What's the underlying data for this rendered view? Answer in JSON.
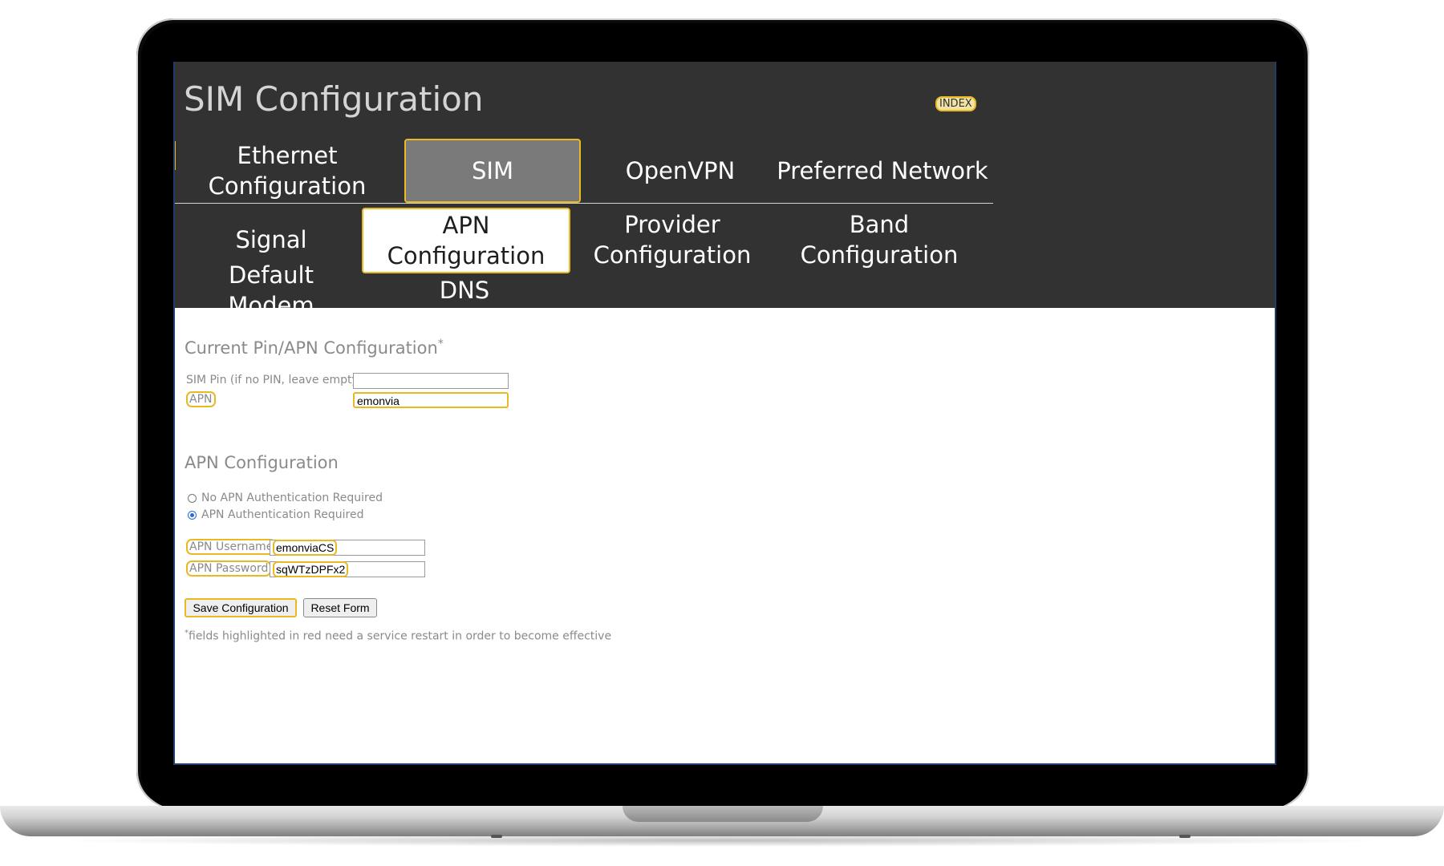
{
  "header": {
    "title": "SIM Configuration",
    "index_link": "INDEX"
  },
  "tabs_primary": [
    {
      "label": "Ethernet Configuration"
    },
    {
      "label": "SIM",
      "active": true
    },
    {
      "label": "OpenVPN"
    },
    {
      "label": "Preferred Network"
    }
  ],
  "tabs_secondary": [
    {
      "label": "Signal"
    },
    {
      "label": "APN Configuration",
      "active": true
    },
    {
      "label": "Provider Configuration"
    },
    {
      "label": "Band Configuration"
    },
    {
      "label": "Default Modem"
    },
    {
      "label": "DNS"
    }
  ],
  "current": {
    "title": "Current Pin/APN Configuration",
    "asterisk": "*",
    "pin_label": "SIM Pin (if no PIN, leave empty)",
    "pin_value": "",
    "apn_label": "APN",
    "apn_value": "emonvia"
  },
  "apn_config": {
    "title": "APN Configuration",
    "radio_none": "No APN Authentication Required",
    "radio_auth": "APN Authentication Required",
    "selected": "APN Authentication Required",
    "username_label": "APN Username",
    "username_value": "emonviaCS",
    "password_label": "APN Password",
    "password_value": "sqWTzDPFx2"
  },
  "buttons": {
    "save": "Save Configuration",
    "reset": "Reset Form"
  },
  "footnote": {
    "asterisk": "*",
    "text": "fields highlighted in red need a service restart in order to become effective"
  },
  "colors": {
    "header_bg": "#323232",
    "highlight": "#e8b922",
    "active_tab_bg": "#7a7a7a",
    "muted_text": "#8a8a8a"
  }
}
